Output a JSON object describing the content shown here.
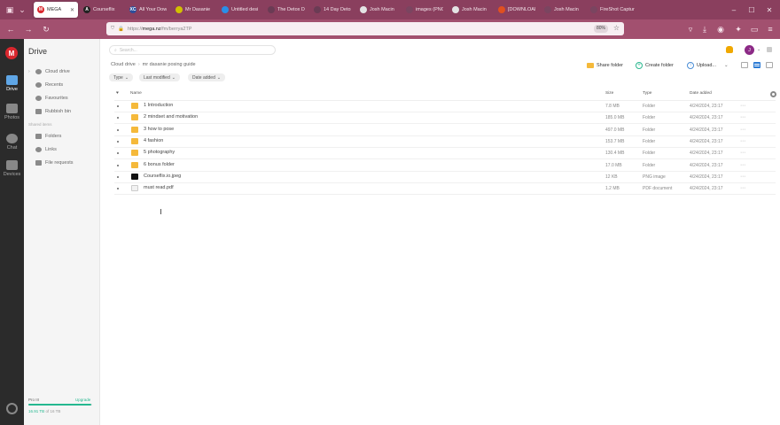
{
  "tabs": [
    {
      "label": "MEGA",
      "active": true,
      "color": "#d9272e",
      "glyph": "M"
    },
    {
      "label": "Courseflix",
      "active": false,
      "color": "#222",
      "glyph": "A"
    },
    {
      "label": "All Your Dow",
      "active": false,
      "color": "#2b4e9b",
      "glyph": "XC"
    },
    {
      "label": "Mr Dasanie",
      "active": false,
      "color": "#d2c000",
      "glyph": ""
    },
    {
      "label": "Untitled desi",
      "active": false,
      "color": "#2a8fe8",
      "glyph": ""
    },
    {
      "label": "The Detox D",
      "active": false,
      "color": "#6a3b54",
      "glyph": ""
    },
    {
      "label": "14 Day Detoxflix",
      "active": false,
      "color": "#6a3b54",
      "glyph": ""
    },
    {
      "label": "Josh Macin",
      "active": false,
      "color": "#e4e4e4",
      "glyph": ""
    },
    {
      "label": "images (PNG Imag",
      "active": false,
      "color": "#7a4560",
      "glyph": ""
    },
    {
      "label": "Josh Macin",
      "active": false,
      "color": "#e4e4e4",
      "glyph": ""
    },
    {
      "label": "[DOWNLOAD",
      "active": false,
      "color": "#e05020",
      "glyph": ""
    },
    {
      "label": "Josh Macin",
      "active": false,
      "color": "#7a4560",
      "glyph": ""
    },
    {
      "label": "FireShot Captur",
      "active": false,
      "color": "#7a4560",
      "glyph": ""
    }
  ],
  "url": {
    "prefix": "https://",
    "domain": "mega.nz",
    "path": "/fm/berrya2TP",
    "zoom": "80%"
  },
  "rail": {
    "items": [
      {
        "label": "Drive",
        "active": true
      },
      {
        "label": "Photos",
        "active": false
      },
      {
        "label": "Chat",
        "active": false
      },
      {
        "label": "Devices",
        "active": false
      }
    ]
  },
  "sidebar": {
    "title": "Drive",
    "items": [
      "Cloud drive",
      "Recents",
      "Favourites",
      "Rubbish bin"
    ],
    "section": "Shared items",
    "shared": [
      "Folders",
      "Links",
      "File requests"
    ],
    "plan": "Pro III",
    "upgrade": "Upgrade",
    "usage_used": "16.91 TB",
    "usage_rest": " of 16 TB",
    "usage_fraction": 0.98
  },
  "search": {
    "placeholder": "Search..."
  },
  "user": {
    "initial": "J"
  },
  "breadcrumb": [
    "Cloud drive",
    "mr dasanie posing guide"
  ],
  "actions": {
    "share": "Share folder",
    "create": "Create folder",
    "upload": "Upload..."
  },
  "filters": [
    "Type",
    "Last modified",
    "Date added"
  ],
  "columns": {
    "name": "Name",
    "size": "Size",
    "type": "Type",
    "date": "Date added"
  },
  "files": [
    {
      "name": "1 Introduction",
      "size": "7.8 MB",
      "type": "Folder",
      "date": "4/24/2024, 23:17",
      "kind": "folder"
    },
    {
      "name": "2 mindset and motivation",
      "size": "185.0 MB",
      "type": "Folder",
      "date": "4/24/2024, 23:17",
      "kind": "folder"
    },
    {
      "name": "3 how to pose",
      "size": "497.0 MB",
      "type": "Folder",
      "date": "4/24/2024, 23:17",
      "kind": "folder"
    },
    {
      "name": "4 fashion",
      "size": "153.7 MB",
      "type": "Folder",
      "date": "4/24/2024, 23:17",
      "kind": "folder"
    },
    {
      "name": "5 photography",
      "size": "130.4 MB",
      "type": "Folder",
      "date": "4/24/2024, 23:17",
      "kind": "folder"
    },
    {
      "name": "6 bonus folder",
      "size": "17.0 MB",
      "type": "Folder",
      "date": "4/24/2024, 23:17",
      "kind": "folder"
    },
    {
      "name": "Courseflix.io.jpeg",
      "size": "12 KB",
      "type": "PNG image",
      "date": "4/24/2024, 23:17",
      "kind": "png"
    },
    {
      "name": "must read.pdf",
      "size": "1.2 MB",
      "type": "PDF document",
      "date": "4/24/2024, 23:17",
      "kind": "pdf"
    }
  ]
}
